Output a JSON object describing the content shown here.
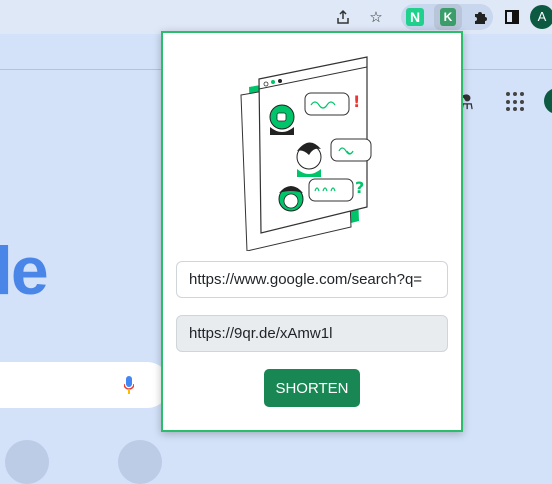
{
  "browser": {
    "extensions": {
      "n_label": "N",
      "k_label": "K"
    },
    "avatar_initial": "A"
  },
  "background_page": {
    "logo_fragment": "le"
  },
  "popup": {
    "url_input_value": "https://www.google.com/search?q=",
    "short_url_value": "https://9qr.de/xAmw1l",
    "shorten_label": "SHORTEN"
  },
  "colors": {
    "accent": "#198754",
    "popup_border": "#2bbd6a",
    "illustration_green": "#00c46a"
  }
}
